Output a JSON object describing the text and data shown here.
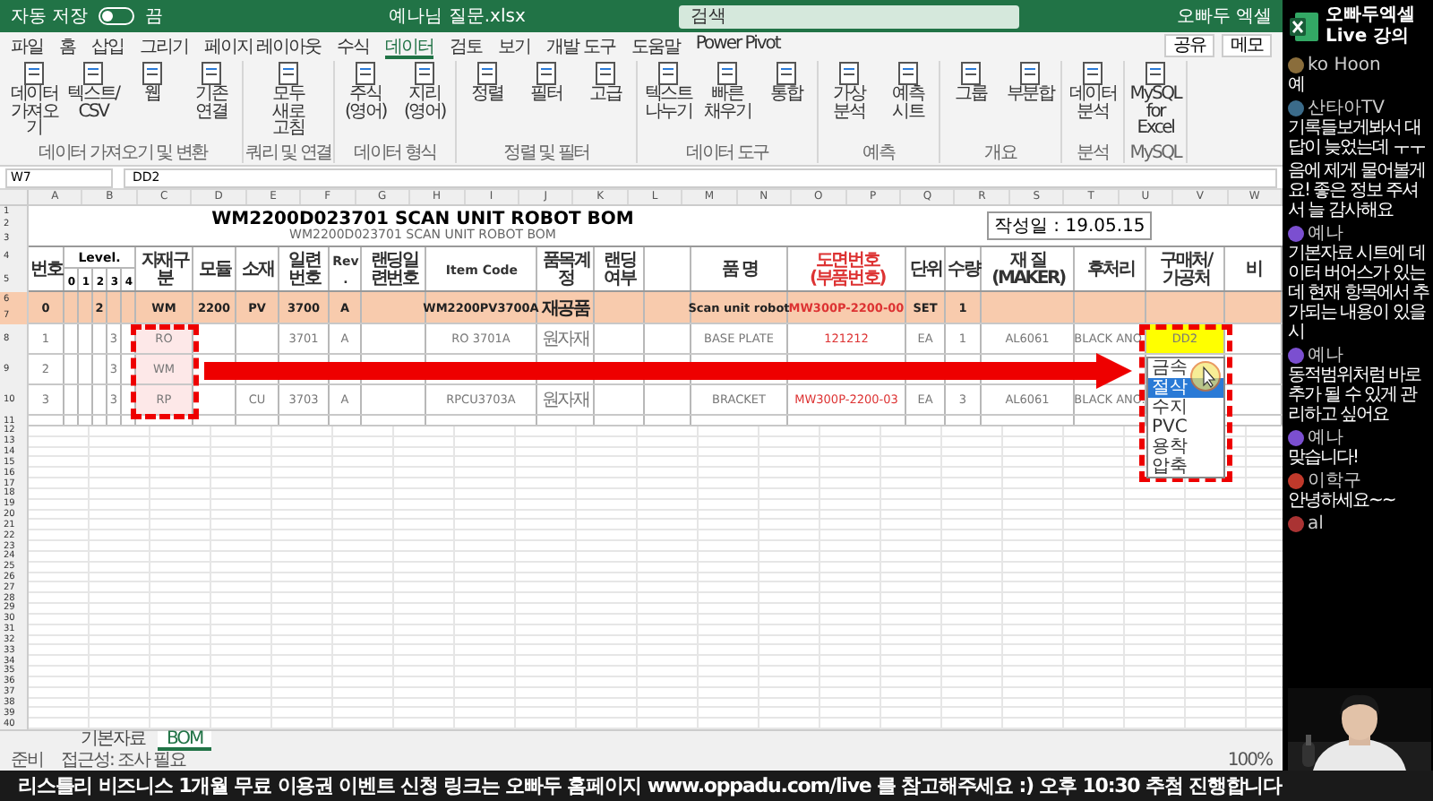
{
  "titlebar": {
    "autosave_label": "자동 저장",
    "autosave_state": "끔",
    "autosave_on": false,
    "filename": "예나님 질문.xlsx",
    "search_placeholder": "검색",
    "user": "오빠두 엑셀"
  },
  "ribbon_tabs": [
    {
      "label": "파일",
      "selected": false
    },
    {
      "label": "홈",
      "selected": false
    },
    {
      "label": "삽입",
      "selected": false
    },
    {
      "label": "그리기",
      "selected": false
    },
    {
      "label": "페이지 레이아웃",
      "selected": false
    },
    {
      "label": "수식",
      "selected": false
    },
    {
      "label": "데이터",
      "selected": true
    },
    {
      "label": "검토",
      "selected": false
    },
    {
      "label": "보기",
      "selected": false
    },
    {
      "label": "개발 도구",
      "selected": false
    },
    {
      "label": "도움말",
      "selected": false
    },
    {
      "label": "Power Pivot",
      "selected": false
    }
  ],
  "ribbon_actions": [
    "공유",
    "메모"
  ],
  "ribbon_groups": [
    {
      "label": "데이터 가져오기 및 변환",
      "buttons": [
        "데이터 가져오기",
        "텍스트/CSV",
        "웹",
        "기존 연결"
      ]
    },
    {
      "label": "쿼리 및 연결",
      "buttons": [
        "모두 새로 고침"
      ]
    },
    {
      "label": "데이터 형식",
      "buttons": [
        "주식 (영어)",
        "지리 (영어)"
      ]
    },
    {
      "label": "정렬 및 필터",
      "buttons": [
        "정렬",
        "필터",
        "고급"
      ]
    },
    {
      "label": "데이터 도구",
      "buttons": [
        "텍스트 나누기",
        "빠른 채우기",
        "통합"
      ]
    },
    {
      "label": "예측",
      "buttons": [
        "가상 분석",
        "예측 시트"
      ]
    },
    {
      "label": "개요",
      "buttons": [
        "그룹",
        "부분합"
      ]
    },
    {
      "label": "분석",
      "buttons": [
        "데이터 분석"
      ]
    },
    {
      "label": "MySQL",
      "buttons": [
        "MySQL for Excel"
      ]
    }
  ],
  "formula_bar": {
    "name_box": "W7",
    "value": "DD2"
  },
  "columns": [
    "A",
    "B",
    "C",
    "D",
    "E",
    "F",
    "G",
    "H",
    "I",
    "J",
    "K",
    "L",
    "M",
    "N",
    "O",
    "P",
    "Q",
    "R",
    "S",
    "T",
    "U",
    "V",
    "W"
  ],
  "title_rows": [
    "1",
    "2",
    "3"
  ],
  "sheet_title": "WM2200D023701 SCAN UNIT ROBOT BOM",
  "sheet_title_echo": "WM2200D023701 SCAN UNIT ROBOT BOM",
  "date_label": "작성일 : 19.05.15",
  "bom": {
    "header_rows": [
      "4",
      "5"
    ],
    "headers": {
      "no": "번호",
      "level_group": "Level.",
      "type": "자재구분",
      "module": "모듈",
      "material": "소재",
      "serial": "일련번호",
      "rev": "Rev.",
      "landing_serial": "랜딩일련번호",
      "item_code": "Item Code",
      "account": "품목계정",
      "landing": "랜딩여부",
      "name": "품 명",
      "drawing": "도면번호 (부품번호)",
      "unit": "단위",
      "qty": "수량",
      "spec": "재 질 (MAKER)",
      "finish": "후처리",
      "vendor": "구매처/가공처",
      "note": "비"
    },
    "level_digits": [
      "0",
      "1",
      "2",
      "3",
      "4"
    ],
    "rows": [
      {
        "kind": "assembly",
        "row_numbers": [
          "6",
          "7"
        ],
        "no": "0",
        "lv2": "2",
        "type": "WM",
        "module": "2200",
        "material": "PV",
        "serial": "3700",
        "rev": "A",
        "item_code": "WM2200PV3700A",
        "account": "재공품",
        "name": "Scan unit robot",
        "drawing": "MW300P-2200-00",
        "unit": "SET",
        "qty": "1"
      },
      {
        "kind": "part",
        "row_numbers": [
          "8"
        ],
        "no": "1",
        "lv3": "3",
        "type": "RO",
        "serial": "3701",
        "rev": "A",
        "item_code": "RO 3701A",
        "account": "원자재",
        "name": "BASE PLATE",
        "drawing": "121212",
        "unit": "EA",
        "qty": "1",
        "spec": "AL6061",
        "finish": "BLACK ANO.",
        "vendor": "DD2"
      },
      {
        "kind": "part",
        "row_numbers": [
          "9"
        ],
        "no": "2",
        "lv3": "3",
        "type": "WM"
      },
      {
        "kind": "part",
        "row_numbers": [
          "10"
        ],
        "no": "3",
        "lv3": "3",
        "type": "RP",
        "material": "CU",
        "serial": "3703",
        "rev": "A",
        "item_code": "RPCU3703A",
        "account": "원자재",
        "name": "BRACKET",
        "drawing": "MW300P-2200-03",
        "unit": "EA",
        "qty": "3",
        "spec": "AL6061",
        "finish": "BLACK ANO."
      }
    ],
    "after_rows": [
      "11"
    ]
  },
  "dropdown": {
    "items": [
      {
        "label": "금속",
        "selected": false
      },
      {
        "label": "절삭",
        "selected": true
      },
      {
        "label": "수지",
        "selected": false
      },
      {
        "label": "PVC",
        "selected": false
      },
      {
        "label": "용착",
        "selected": false
      },
      {
        "label": "압축",
        "selected": false
      }
    ]
  },
  "empty_rows": [
    "12",
    "13",
    "14",
    "15",
    "16",
    "17",
    "18",
    "19",
    "20",
    "21",
    "22",
    "23",
    "24",
    "25",
    "26",
    "27",
    "28",
    "29",
    "30",
    "31",
    "32",
    "33",
    "34",
    "35",
    "36",
    "37",
    "38",
    "39",
    "40"
  ],
  "sheet_tabs": [
    {
      "label": "기본자료",
      "selected": false
    },
    {
      "label": "BOM",
      "selected": true
    }
  ],
  "status": {
    "ready": "준비",
    "accessibility": "접근성: 조사 필요",
    "zoom": "100%"
  },
  "chat": {
    "title_line1": "오빠두엑셀",
    "title_line2": "Live 강의",
    "messages": [
      {
        "author": "ko Hoon",
        "text": "예",
        "color": "#8a6d3b"
      },
      {
        "author": "산타아TV",
        "text": "기록들보게봐서 대답이 늦었는데 ㅜㅜ",
        "color": "#3b6b8a"
      },
      {
        "text": "음에 제게 물어볼게요! 좋은 정보 주셔서 늘 감사해요"
      },
      {
        "author": "예나",
        "text": "기본자료 시트에 데이터 버어스가 있는데 현재 항목에서 추가되는 내용이 있을시",
        "color": "#7b4fd0"
      },
      {
        "author": "예나",
        "text": "동적범위처럼 바로 추가 될 수 있게 관리하고 싶어요",
        "color": "#7b4fd0"
      },
      {
        "author": "예나",
        "text": "맞습니다!",
        "color": "#7b4fd0"
      },
      {
        "author": "이학구",
        "text": "안녕하세요~~",
        "color": "#c0392b"
      },
      {
        "author": "al",
        "color": "#a33"
      }
    ]
  },
  "ticker": "리스틀리 비즈니스 1개월 무료 이용권 이벤트 신청 링크는 오빠두 홈페이지 www.oppadu.com/live 를 참고해주세요 :) 오후 10:30 추첨 진행합니다"
}
